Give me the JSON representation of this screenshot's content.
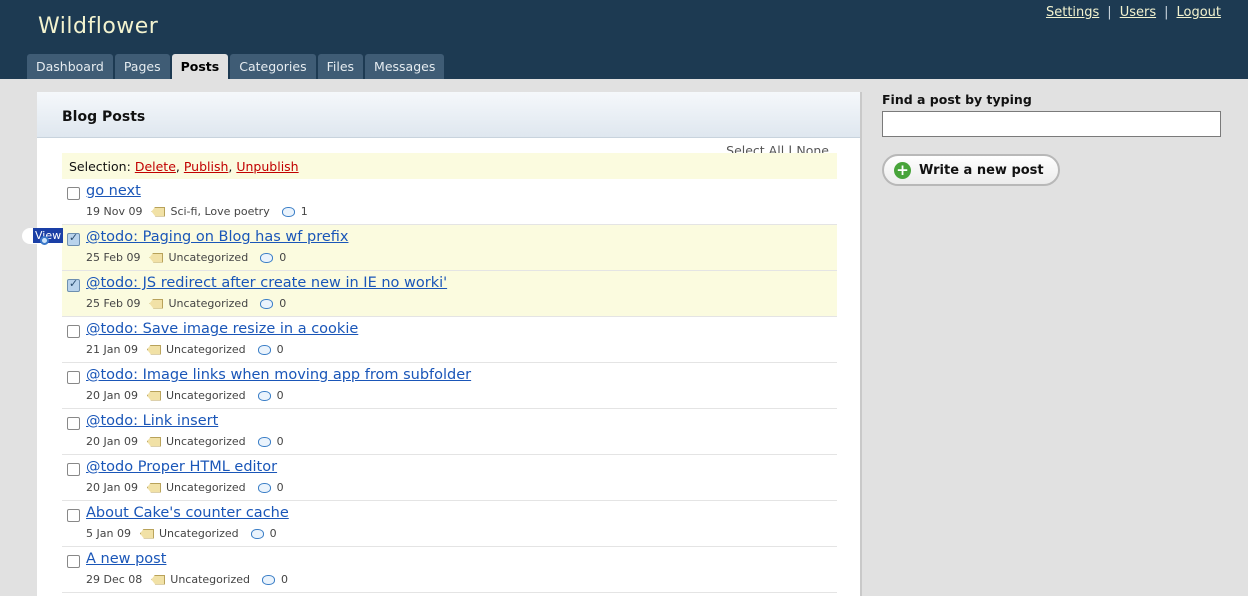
{
  "app": {
    "title": "Wildflower"
  },
  "top_links": [
    {
      "label": "Settings"
    },
    {
      "label": "Users"
    },
    {
      "label": "Logout"
    }
  ],
  "tabs": [
    {
      "label": "Dashboard",
      "active": false
    },
    {
      "label": "Pages",
      "active": false
    },
    {
      "label": "Posts",
      "active": true
    },
    {
      "label": "Categories",
      "active": false
    },
    {
      "label": "Files",
      "active": false
    },
    {
      "label": "Messages",
      "active": false
    }
  ],
  "panel": {
    "title": "Blog Posts"
  },
  "select_links": {
    "all": "Select All",
    "separator": "|",
    "none": "None"
  },
  "selection_bar": {
    "label": "Selection:",
    "actions": [
      "Delete",
      "Publish",
      "Unpublish"
    ]
  },
  "posts": [
    {
      "title": "go next",
      "date": "19 Nov 09",
      "categories": "Sci-fi, Love poetry",
      "comments": "1",
      "checked": false
    },
    {
      "title": "@todo: Paging on Blog has wf prefix",
      "date": "25 Feb 09",
      "categories": "Uncategorized",
      "comments": "0",
      "checked": true
    },
    {
      "title": "@todo: JS redirect after create new in IE no worki'",
      "date": "25 Feb 09",
      "categories": "Uncategorized",
      "comments": "0",
      "checked": true
    },
    {
      "title": "@todo: Save image resize in a cookie",
      "date": "21 Jan 09",
      "categories": "Uncategorized",
      "comments": "0",
      "checked": false
    },
    {
      "title": "@todo: Image links when moving app from subfolder",
      "date": "20 Jan 09",
      "categories": "Uncategorized",
      "comments": "0",
      "checked": false
    },
    {
      "title": "@todo: Link insert",
      "date": "20 Jan 09",
      "categories": "Uncategorized",
      "comments": "0",
      "checked": false
    },
    {
      "title": "@todo Proper HTML editor",
      "date": "20 Jan 09",
      "categories": "Uncategorized",
      "comments": "0",
      "checked": false
    },
    {
      "title": "About Cake's counter cache",
      "date": "5 Jan 09",
      "categories": "Uncategorized",
      "comments": "0",
      "checked": false
    },
    {
      "title": "A new post",
      "date": "29 Dec 08",
      "categories": "Uncategorized",
      "comments": "0",
      "checked": false
    }
  ],
  "view_badge": {
    "label": "View"
  },
  "sidebar": {
    "find_label": "Find a post by typing",
    "find_value": "",
    "write_button": "Write a new post"
  },
  "icons": {
    "tag": "tag-icon",
    "comment": "comment-icon",
    "plus": "plus-icon",
    "view": "magnifier-icon"
  }
}
